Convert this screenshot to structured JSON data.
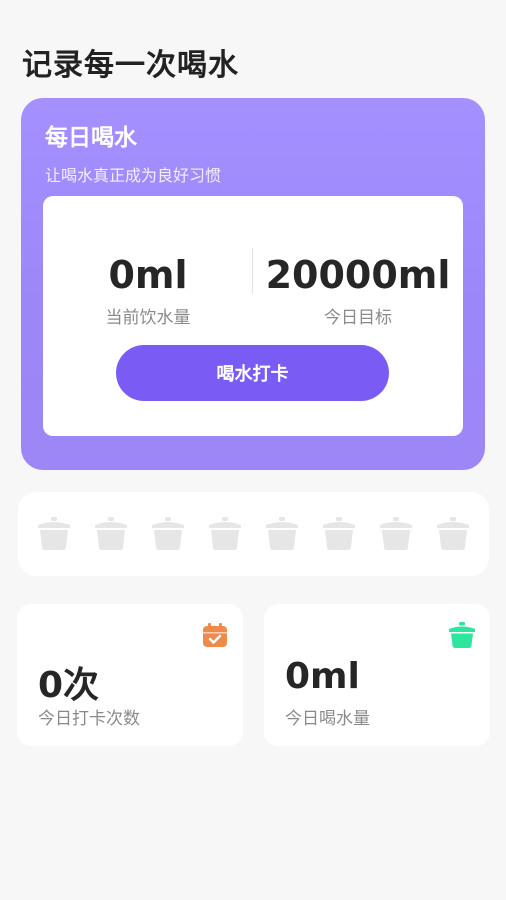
{
  "page": {
    "title": "记录每一次喝水"
  },
  "hero": {
    "title": "每日喝水",
    "subtitle": "让喝水真正成为良好习惯",
    "current_value": "0ml",
    "current_label": "当前饮水量",
    "goal_value": "20000ml",
    "goal_label": "今日目标",
    "checkin_label": "喝水打卡",
    "accent_color": "#7a5cf5"
  },
  "cups": {
    "count": 8,
    "filled": 0,
    "icon": "cup-icon",
    "empty_color": "#e6e6e6"
  },
  "stats": {
    "checkins": {
      "value": "0次",
      "label": "今日打卡次数",
      "icon": "calendar-check-icon",
      "icon_color": "#f08a4b"
    },
    "intake": {
      "value": "0ml",
      "label": "今日喝水量",
      "icon": "cup-icon",
      "icon_color": "#2ee59d"
    }
  }
}
